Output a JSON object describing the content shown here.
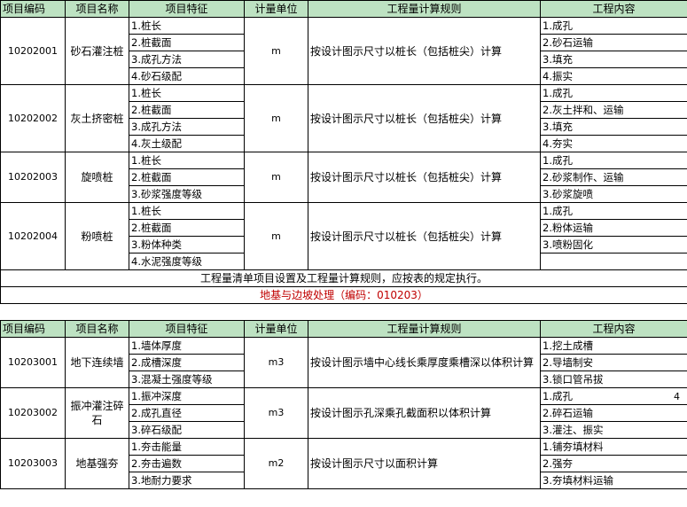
{
  "headers": [
    "项目编码",
    "项目名称",
    "项目特征",
    "计量单位",
    "工程量计算规则",
    "工程内容"
  ],
  "table1": [
    {
      "code": "10202001",
      "name": "砂石灌注桩",
      "features": [
        "1.桩长",
        "2.桩截面",
        "3.成孔方法",
        "4.砂石级配"
      ],
      "unit": "m",
      "rule": "按设计图示尺寸以桩长（包括桩尖）计算",
      "content": [
        "1.成孔",
        "2.砂石运输",
        "3.填充",
        "4.振实"
      ]
    },
    {
      "code": "10202002",
      "name": "灰土挤密桩",
      "features": [
        "1.桩长",
        "2.桩截面",
        "3.成孔方法",
        "4.灰土级配"
      ],
      "unit": "m",
      "rule": "按设计图示尺寸以桩长（包括桩尖）计算",
      "content": [
        "1.成孔",
        "2.灰土拌和、运输",
        "3.填充",
        "4.夯实"
      ]
    },
    {
      "code": "10202003",
      "name": "旋喷桩",
      "features": [
        "1.桩长",
        "2.桩截面",
        "3.砂浆强度等级"
      ],
      "unit": "m",
      "rule": "按设计图示尺寸以桩长（包括桩尖）计算",
      "content": [
        "1.成孔",
        "2.砂浆制作、运输",
        "3.砂浆旋喷"
      ]
    },
    {
      "code": "10202004",
      "name": "粉喷桩",
      "features": [
        "1.桩长",
        "2.桩截面",
        "3.粉体种类",
        "4.水泥强度等级"
      ],
      "unit": "m",
      "rule": "按设计图示尺寸以桩长（包括桩尖）计算",
      "content": [
        "1.成孔",
        "2.粉体运输",
        "3.喷粉固化"
      ]
    }
  ],
  "note": "工程量清单项目设置及工程量计算规则，应按表的规定执行。",
  "section_title": "地基与边坡处理（编码：010203）",
  "table2": [
    {
      "code": "10203001",
      "name": "地下连续墙",
      "features": [
        "1.墙体厚度",
        "2.成槽深度",
        "3.混凝土强度等级"
      ],
      "unit": "m3",
      "rule": "按设计图示墙中心线长乘厚度乘槽深以体积计算",
      "content": [
        "1.挖土成槽",
        "2.导墙制安",
        "3.锁口管吊拔"
      ]
    },
    {
      "code": "10203002",
      "name": "振冲灌注碎石",
      "features": [
        "1.振冲深度",
        "2.成孔直径",
        "3.碎石级配"
      ],
      "unit": "m3",
      "rule": "按设计图示孔深乘孔截面积以体积计算",
      "content": [
        "1.成孔",
        "2.碎石运输",
        "3.灌注、振实"
      ]
    },
    {
      "code": "10203003",
      "name": "地基强夯",
      "features": [
        "1.夯击能量",
        "2.夯击遍数",
        "3.地耐力要求"
      ],
      "unit": "m2",
      "rule": "按设计图示尺寸以面积计算",
      "content": [
        "1.铺夯填材料",
        "2.强夯",
        "3.夯填材料运输"
      ]
    }
  ],
  "page_number": "4",
  "colors": {
    "header_bg": "#bde2c2",
    "section_text": "#c00000"
  }
}
